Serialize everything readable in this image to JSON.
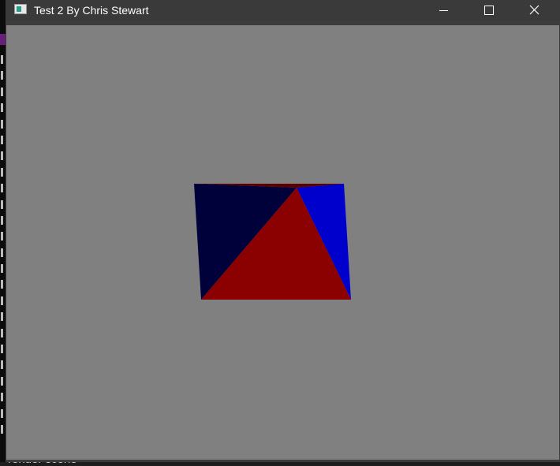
{
  "window": {
    "title": "Test 2 By Chris Stewart",
    "icon": "app-window-icon",
    "controls": {
      "minimize_icon": "minimize-icon",
      "maximize_icon": "maximize-icon",
      "close_icon": "close-icon"
    }
  },
  "viewport": {
    "background_color": "#808080",
    "shape": "pyramid",
    "face_colors": {
      "front": "#8b0000",
      "left": "#00003a",
      "right": "#0000cc"
    }
  },
  "background": {
    "status_text": "render scene"
  }
}
